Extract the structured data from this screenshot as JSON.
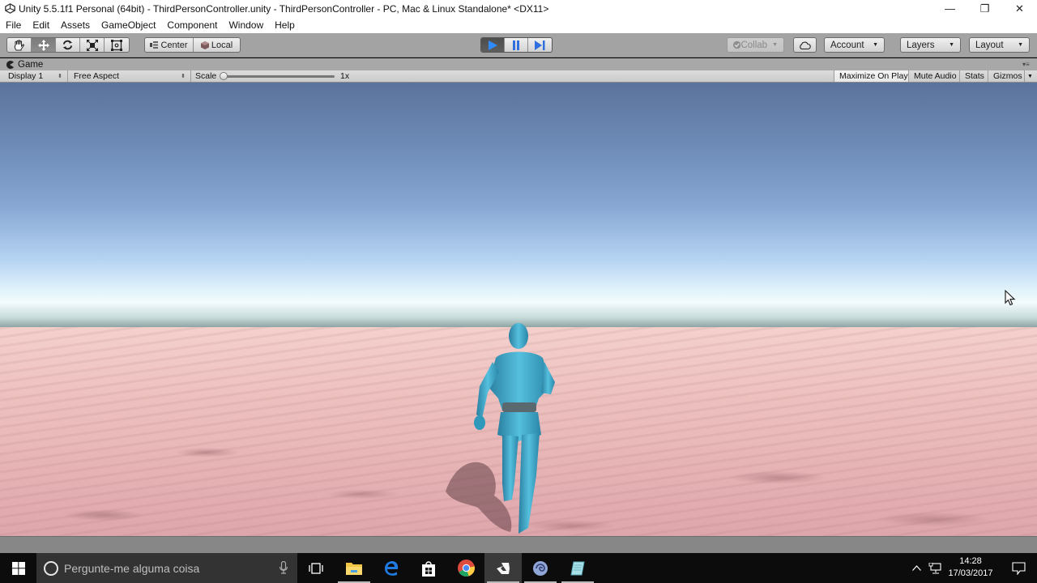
{
  "window": {
    "title": "Unity 5.5.1f1 Personal (64bit) - ThirdPersonController.unity - ThirdPersonController - PC, Mac & Linux Standalone* <DX11>",
    "controls": {
      "minimize": "—",
      "restore": "❐",
      "close": "✕"
    }
  },
  "menubar": {
    "items": [
      {
        "label": "File"
      },
      {
        "label": "Edit"
      },
      {
        "label": "Assets"
      },
      {
        "label": "GameObject"
      },
      {
        "label": "Component"
      },
      {
        "label": "Window"
      },
      {
        "label": "Help"
      }
    ]
  },
  "toolbar": {
    "transform_tools": [
      {
        "name": "hand-tool",
        "icon": "hand-icon"
      },
      {
        "name": "move-tool",
        "icon": "move-icon",
        "active": true
      },
      {
        "name": "rotate-tool",
        "icon": "rotate-icon"
      },
      {
        "name": "scale-tool",
        "icon": "scale-icon"
      },
      {
        "name": "rect-tool",
        "icon": "rect-icon"
      }
    ],
    "pivot_mode": "Center",
    "pivot_rotation": "Local",
    "playback": {
      "play_active": true,
      "pause_active": false,
      "step_active": false
    },
    "collab_label": "Collab",
    "cloud_icon": "cloud-icon",
    "account_label": "Account",
    "layers_label": "Layers",
    "layout_label": "Layout",
    "accent_color": "#2f8cff"
  },
  "game_view": {
    "tab_label": "Game",
    "display_selected": "Display 1",
    "aspect_selected": "Free Aspect",
    "scale_label": "Scale",
    "scale_value": "1x",
    "scale_fraction": 0.0,
    "maximize_on_play": "Maximize On Play",
    "mute_audio": "Mute Audio",
    "stats": "Stats",
    "gizmos": "Gizmos"
  },
  "scene": {
    "sky_color_top": "#5b739c",
    "horizon_color": "#f2fbfd",
    "ground_color": "#eec2c0",
    "character_color": "#3fa8c8"
  },
  "taskbar": {
    "search_placeholder": "Pergunte-me alguma coisa",
    "pinned": [
      {
        "name": "task-view",
        "icon": "task-view-icon"
      },
      {
        "name": "file-explorer",
        "icon": "folder-icon"
      },
      {
        "name": "edge",
        "icon": "edge-icon"
      },
      {
        "name": "store",
        "icon": "store-icon"
      },
      {
        "name": "chrome",
        "icon": "chrome-icon"
      },
      {
        "name": "unity",
        "icon": "unity-icon",
        "active": true
      },
      {
        "name": "app-swirl",
        "icon": "swirl-app-icon"
      },
      {
        "name": "app-notepad",
        "icon": "notepad-icon"
      }
    ],
    "clock": {
      "time": "14:28",
      "date": "17/03/2017"
    }
  }
}
